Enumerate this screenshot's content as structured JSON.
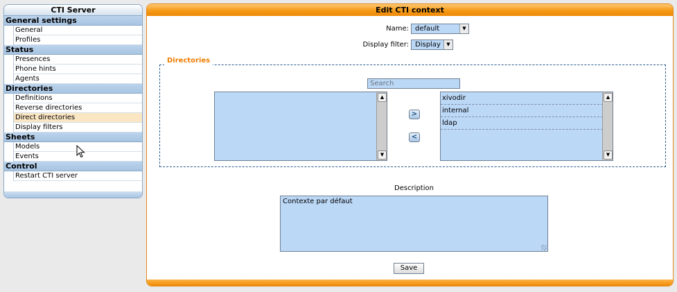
{
  "sidebar": {
    "title": "CTI Server",
    "sections": [
      {
        "title": "General settings",
        "items": [
          {
            "label": "General"
          },
          {
            "label": "Profiles"
          }
        ]
      },
      {
        "title": "Status",
        "items": [
          {
            "label": "Presences"
          },
          {
            "label": "Phone hints"
          },
          {
            "label": "Agents"
          }
        ]
      },
      {
        "title": "Directories",
        "items": [
          {
            "label": "Definitions"
          },
          {
            "label": "Reverse directories"
          },
          {
            "label": "Direct directories",
            "active": true
          },
          {
            "label": "Display filters"
          }
        ]
      },
      {
        "title": "Sheets",
        "items": [
          {
            "label": "Models"
          },
          {
            "label": "Events"
          }
        ]
      },
      {
        "title": "Control",
        "items": [
          {
            "label": "Restart CTI server"
          }
        ]
      }
    ]
  },
  "main": {
    "title": "Edit CTI context",
    "name_label": "Name:",
    "name_value": "default",
    "display_filter_label": "Display filter:",
    "display_filter_value": "Display",
    "directories": {
      "legend": "Directories",
      "search_placeholder": "Search",
      "available": [],
      "selected": [
        "xivodir",
        "internal",
        "ldap"
      ],
      "move_right": ">",
      "move_left": "<"
    },
    "description_label": "Description",
    "description_value": "Contexte par défaut",
    "save_label": "Save"
  },
  "colors": {
    "accent_orange": "#f59a16",
    "sidebar_blue": "#a7c4e2",
    "field_blue": "#bcd8f7",
    "active_item": "#fbe6c4"
  },
  "icons": [
    "chevron-down-icon",
    "scroll-up-icon",
    "scroll-down-icon",
    "arrow-right-icon",
    "arrow-left-icon",
    "resize-grip-icon",
    "mouse-cursor-icon"
  ]
}
